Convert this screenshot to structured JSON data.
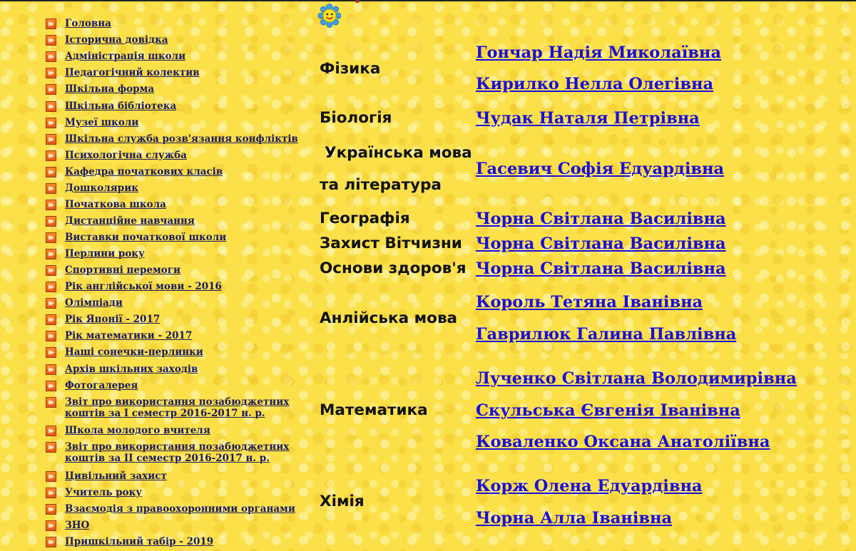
{
  "sidebar": {
    "items": [
      {
        "label": "Головна"
      },
      {
        "label": "Історична довідка"
      },
      {
        "label": "Адміністрація школи"
      },
      {
        "label": "Педагогічний колектив"
      },
      {
        "label": "Шкільна форма"
      },
      {
        "label": "Шкільна бібліотека"
      },
      {
        "label": "Музеї школи"
      },
      {
        "label": "Шкільна служба розв'язання конфліктів"
      },
      {
        "label": "Психологічна служба"
      },
      {
        "label": "Кафедра початкових класів"
      },
      {
        "label": "Дошколярик"
      },
      {
        "label": "Початкова школа"
      },
      {
        "label": "Дистанційне навчання"
      },
      {
        "label": "Виставки початкової школи"
      },
      {
        "label": "Перлини року"
      },
      {
        "label": "Спортивні перемоги"
      },
      {
        "label": "Рік англійської мови - 2016"
      },
      {
        "label": "Олімпіади"
      },
      {
        "label": "Рік Японії - 2017"
      },
      {
        "label": "Рік математики - 2017"
      },
      {
        "label": "Наші сонечки-перлинки"
      },
      {
        "label": "Архів шкільних заходів"
      },
      {
        "label": "Фотогалерея"
      },
      {
        "label": "Звіт про використання позабюджетних коштів за I семестр 2016-2017 н. р."
      },
      {
        "label": "Школа молодого вчителя"
      },
      {
        "label": "Звіт про використання позабюджетних коштів за II семестр 2016-2017 н. р."
      },
      {
        "label": "Цивільний захист"
      },
      {
        "label": "Учитель року"
      },
      {
        "label": "Взаємодія з правоохоронними органами"
      },
      {
        "label": "ЗНО"
      },
      {
        "label": "Пришкільний табір - 2019"
      }
    ]
  },
  "subjects": {
    "physics": "Фізика",
    "biology": "Біологія",
    "ukrainian_line1": "Українська мова",
    "ukrainian_line2": "та література",
    "geography": "Географія",
    "defense": "Захист Вітчизни",
    "health": "Основи здоров'я",
    "english": "Анлійська мова",
    "math": "Математика",
    "chemistry": "Хімія"
  },
  "teachers": {
    "physics": [
      "Гончар Надія Миколаївна",
      "Кирилко Нелла Олегівна"
    ],
    "biology": [
      "Чудак Наталя Петрівна"
    ],
    "ukrainian": [
      "Гасевич Софія Едуардівна"
    ],
    "geography": [
      "Чорна Світлана Василівна"
    ],
    "defense": [
      "Чорна Світлана Василівна"
    ],
    "health": [
      "Чорна Світлана Василівна"
    ],
    "english": [
      "Король Тетяна Іванівна",
      "Гаврилюк Галина Павлівна"
    ],
    "math": [
      "Лученко Світлана Володимирівна",
      "Скульська Євгенія Іванівна",
      "Коваленко Оксана Анатоліївна"
    ],
    "chemistry": [
      "Корж Олена Едуардівна",
      "Чорна Алла Іванівна"
    ]
  },
  "icons": {
    "bullet": "orange-arrow-bullet-icon",
    "smiley": "smiley-flower-icon"
  },
  "colors": {
    "background": "#fbe04a",
    "nav_link": "#1a1a5e",
    "teacher_link": "#1a0ddb",
    "bullet": "#f26a22"
  }
}
